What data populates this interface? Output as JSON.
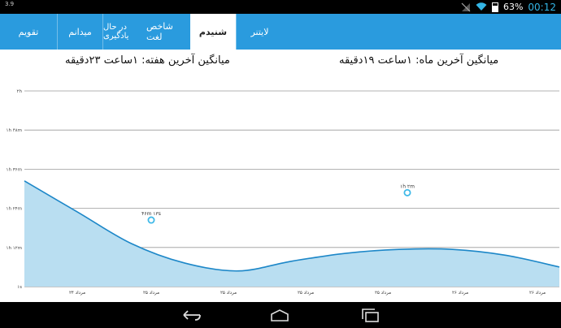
{
  "status_bar": {
    "left_text": "3.9",
    "battery_percent": "63%",
    "time": "00:12",
    "icons": [
      "no-signal-icon",
      "wifi-icon",
      "battery-icon"
    ]
  },
  "tabs": [
    {
      "label": "تقویم",
      "active": false
    },
    {
      "label": "میدانم",
      "active": false
    },
    {
      "label": "در حال یادگیری",
      "active": false
    },
    {
      "label": "شاخص لغت",
      "active": false
    },
    {
      "label": "شنیدم",
      "active": true
    },
    {
      "label": "لایتنر",
      "active": false
    }
  ],
  "summary": {
    "month_avg": "میانگین آخرین ماه: ۱ساعت ۱۹دقیقه",
    "week_avg": "میانگین آخرین هفته: ۱ساعت ۲۳دقیقه"
  },
  "chart_data": {
    "type": "area",
    "y_ticks": [
      "۲h",
      "۱h ۴۸m",
      "۱h ۳۶m",
      "۱h ۲۴m",
      "۱h ۱۲m",
      "۱s"
    ],
    "x_labels": [
      "۲۴ مرداد",
      "۲۵ مرداد",
      "۲۵ مرداد",
      "۲۵ مرداد",
      "۲۵ مرداد",
      "۲۶ مرداد",
      "۲۶ مرداد"
    ],
    "highlighted_points": [
      {
        "label": "۴۶m ۱۳s",
        "value_fraction": 0.66
      },
      {
        "label": "۱h ۲m",
        "value_fraction": 0.52
      }
    ],
    "curve_fractions": [
      0.46,
      0.62,
      0.78,
      0.88,
      0.92,
      0.87,
      0.83,
      0.81,
      0.81,
      0.84,
      0.9
    ],
    "fill_color": "#b9def1",
    "line_color": "#1d87c8",
    "grid": true
  }
}
